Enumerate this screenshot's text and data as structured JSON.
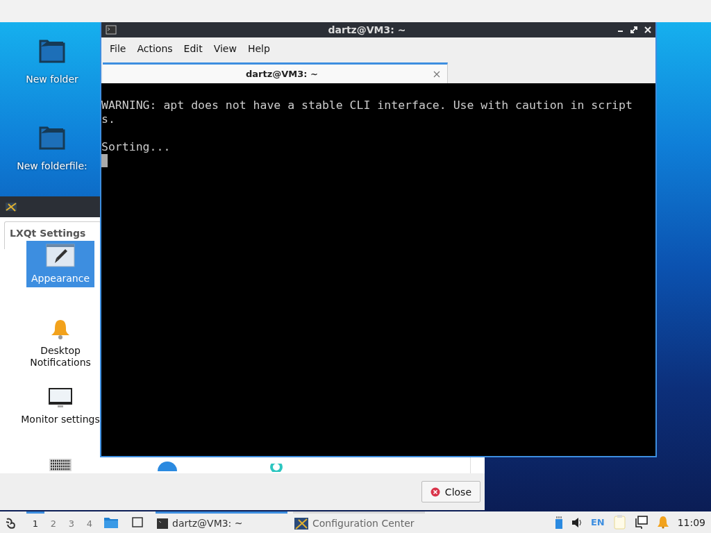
{
  "desktop_icons": [
    {
      "label": "New folder"
    },
    {
      "label": "New folderfile:"
    }
  ],
  "settings_window": {
    "tab": "LXQt Settings",
    "items": [
      {
        "label": "Appearance",
        "kind": "brush",
        "selected": true
      },
      {
        "label": "Desktop Notifications",
        "kind": "bell",
        "selected": false
      },
      {
        "label": "Monitor settings",
        "kind": "monitor",
        "selected": false
      },
      {
        "kind": "keyboard",
        "selected": false
      }
    ],
    "close_button": "Close"
  },
  "terminal_window": {
    "title": "dartz@VM3: ~",
    "menu": [
      "File",
      "Actions",
      "Edit",
      "View",
      "Help"
    ],
    "tab": "dartz@VM3: ~",
    "output": "WARNING: apt does not have a stable CLI interface. Use with caution in script\ns.\n\nSorting...",
    "cursor": true
  },
  "taskbar": {
    "desktops": [
      {
        "label": "1",
        "selected": true
      },
      {
        "label": "2",
        "selected": false
      },
      {
        "label": "3",
        "selected": false
      },
      {
        "label": "4",
        "selected": false
      }
    ],
    "tasks": [
      {
        "label": "dartz@VM3: ~",
        "kind": "terminal",
        "selected": true
      },
      {
        "label": "Configuration Center",
        "kind": "settings",
        "selected": false
      }
    ],
    "keyboard_layout": "EN",
    "clock": "11:09"
  }
}
